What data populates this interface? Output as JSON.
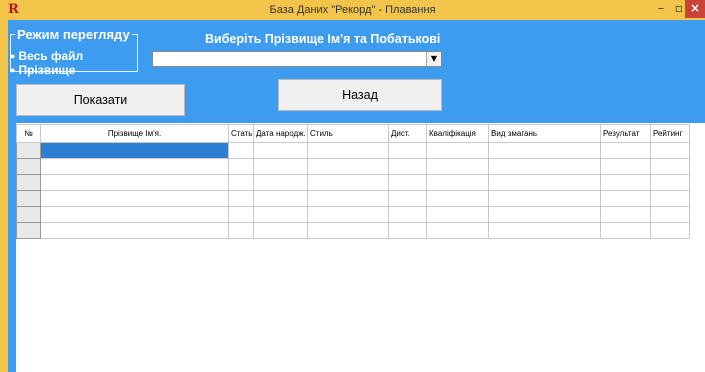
{
  "window": {
    "logo": "R",
    "title": "База Даних \"Рекорд\" - Плавання",
    "minimize": "–",
    "maximize": "▫",
    "close": "×"
  },
  "mode_group": {
    "legend": "Режим перегляду",
    "options": [
      {
        "label": "Весь файл"
      },
      {
        "label": "Прізвище"
      }
    ]
  },
  "selector": {
    "caption": "Виберіть Прізвище Ім'я та Побатькові",
    "value": "",
    "arrow": "▼"
  },
  "buttons": {
    "show": "Показати",
    "back": "Назад"
  },
  "table": {
    "headers": [
      "№",
      "Прізвище Ім'я.",
      "Стать",
      "Дата народж.",
      "Стиль",
      "Дист.",
      "Кваліфікація",
      "Вид змагань",
      "Результат",
      "Рейтинг"
    ],
    "row_count": 6
  },
  "colors": {
    "accent": "#3d9cf0",
    "titlebar": "#f2c54a",
    "selection": "#2d7fd4"
  }
}
